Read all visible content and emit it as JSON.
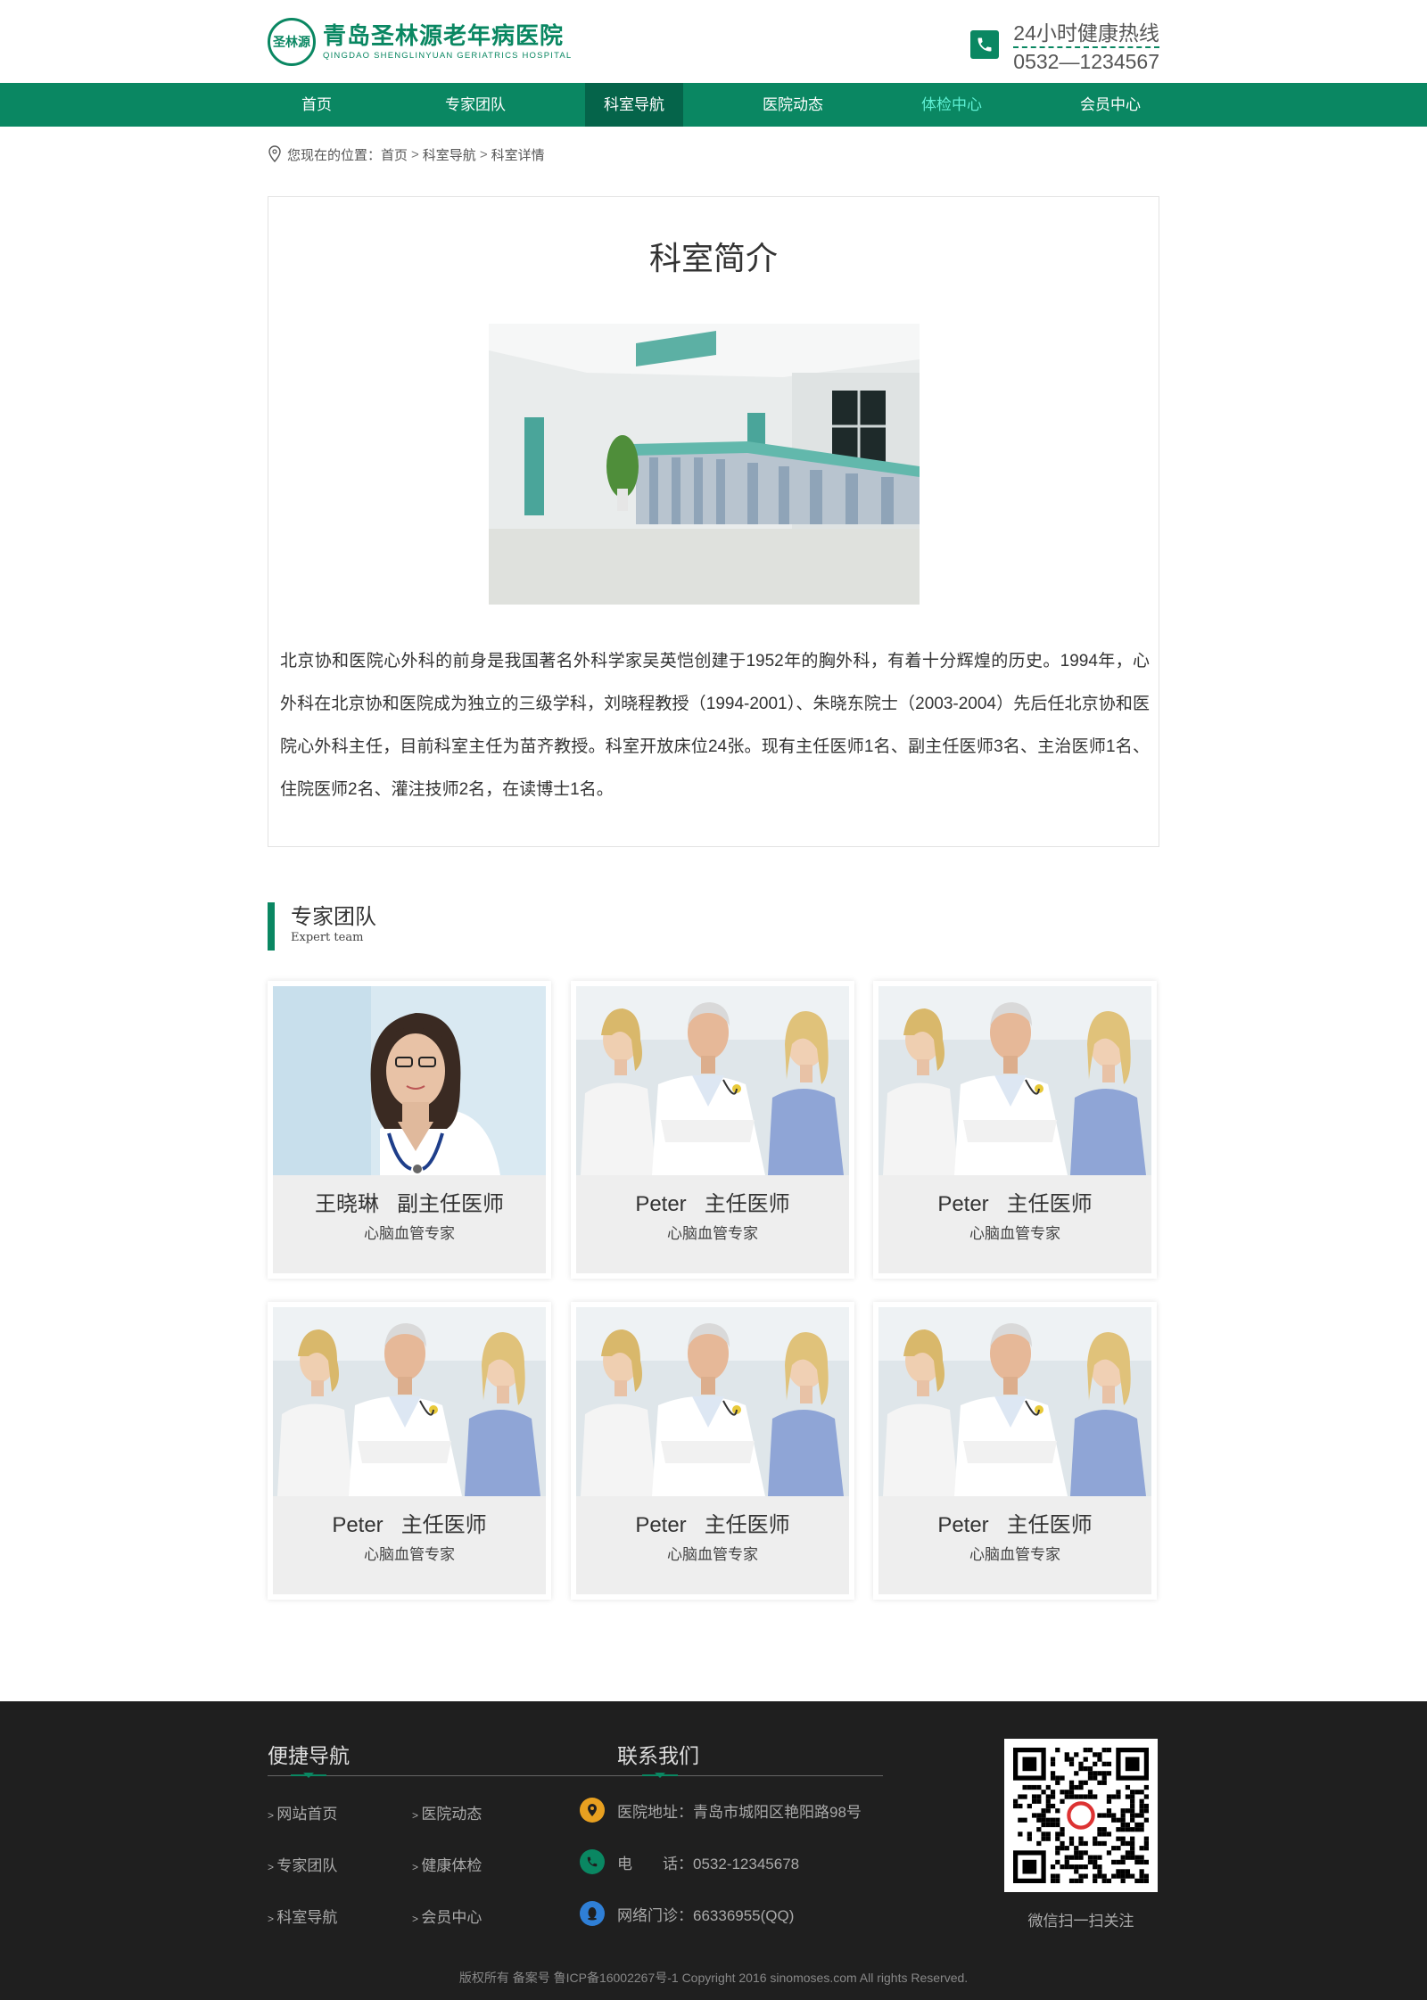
{
  "header": {
    "logo_mark": "圣林源",
    "logo_cn": "青岛圣林源老年病医院",
    "logo_en": "QINGDAO SHENGLINYUAN GERIATRICS HOSPITAL",
    "hotline_title": "24小时健康热线",
    "hotline_number": "0532—1234567",
    "brand_color": "#0a8762"
  },
  "nav": {
    "items": [
      {
        "label": "首页"
      },
      {
        "label": "专家团队"
      },
      {
        "label": "科室导航"
      },
      {
        "label": "医院动态"
      },
      {
        "label": "体检中心"
      },
      {
        "label": "会员中心"
      }
    ],
    "active_index": 2,
    "highlight_index": 4
  },
  "breadcrumb": {
    "prefix": "您现在的位置：",
    "items": [
      "首页",
      "科室导航",
      "科室详情"
    ],
    "separator": ">"
  },
  "intro": {
    "title": "科室简介",
    "body": "北京协和医院心外科的前身是我国著名外科学家吴英恺创建于1952年的胸外科，有着十分辉煌的历史。1994年，心外科在北京协和医院成为独立的三级学科，刘晓程教授（1994-2001）、朱晓东院士（2003-2004）先后任北京协和医院心外科主任，目前科室主任为苗齐教授。科室开放床位24张。现有主任医师1名、副主任医师3名、主治医师1名、住院医师2名、灌注技师2名，在读博士1名。"
  },
  "experts": {
    "title_cn": "专家团队",
    "title_en": "Expert team",
    "cards": [
      {
        "name": "王晓琳",
        "title": "副主任医师",
        "specialty": "心脑血管专家",
        "photo": "single-doctor"
      },
      {
        "name": "Peter",
        "title": "主任医师",
        "specialty": "心脑血管专家",
        "photo": "group-doctors"
      },
      {
        "name": "Peter",
        "title": "主任医师",
        "specialty": "心脑血管专家",
        "photo": "group-doctors"
      },
      {
        "name": "Peter",
        "title": "主任医师",
        "specialty": "心脑血管专家",
        "photo": "group-doctors"
      },
      {
        "name": "Peter",
        "title": "主任医师",
        "specialty": "心脑血管专家",
        "photo": "group-doctors"
      },
      {
        "name": "Peter",
        "title": "主任医师",
        "specialty": "心脑血管专家",
        "photo": "group-doctors"
      }
    ]
  },
  "footer": {
    "nav_title": "便捷导航",
    "contact_title": "联系我们",
    "links_col1": [
      "网站首页",
      "专家团队",
      "科室导航"
    ],
    "links_col2": [
      "医院动态",
      "健康体检",
      "会员中心"
    ],
    "contacts": [
      {
        "icon": "location-icon",
        "text": "医院地址：青岛市城阳区艳阳路98号",
        "color": "#e8a020"
      },
      {
        "icon": "phone-icon",
        "text": "电　　话：0532-12345678",
        "color": "#0a8762"
      },
      {
        "icon": "qq-icon",
        "text": "网络门诊：66336955(QQ)",
        "color": "#2f7fd6"
      }
    ],
    "qr_caption": "微信扫一扫关注",
    "copyright": "版权所有 备案号 鲁ICP备16002267号-1 Copyright 2016 sinomoses.com All rights Reserved."
  }
}
